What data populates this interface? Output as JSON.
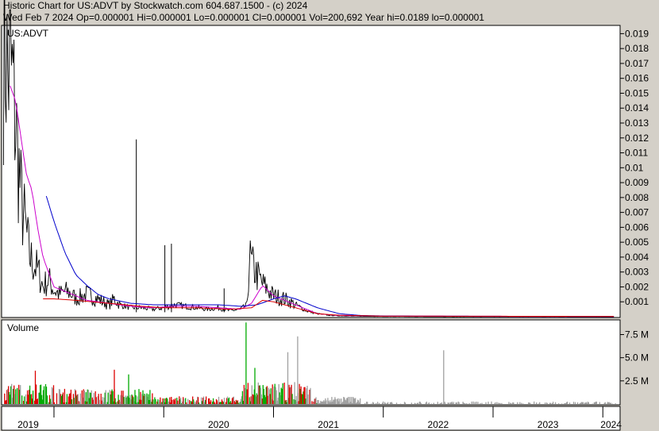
{
  "header": {
    "title": "Historic Chart for US:ADVT by Stockwatch.com 604.687.1500 - (c) 2024",
    "stats": "Wed Feb  7 2024   Op=0.000001   Hi=0.000001   Lo=0.000001   Cl=0.000001   Vol=200,692   Year hi=0.0189   lo=0.000001"
  },
  "chart_data": [
    {
      "type": "line",
      "title": "US:ADVT",
      "time_range": [
        "2018-07",
        "2024-02"
      ],
      "ylim": [
        0,
        0.0195
      ],
      "y_ticks": [
        0.001,
        0.002,
        0.003,
        0.004,
        0.005,
        0.006,
        0.007,
        0.008,
        0.009,
        0.01,
        0.011,
        0.012,
        0.013,
        0.014,
        0.015,
        0.016,
        0.017,
        0.018,
        0.019
      ],
      "y_tick_labels": [
        "0.001",
        "0.002",
        "0.003",
        "0.004",
        "0.005",
        "0.006",
        "0.007",
        "0.008",
        "0.009",
        "0.01",
        "0.011",
        "0.012",
        "0.013",
        "0.014",
        "0.015",
        "0.016",
        "0.017",
        "0.018",
        "0.019"
      ],
      "x_tick_labels": [
        "2019",
        "2020",
        "2021",
        "2022",
        "2023",
        "2024"
      ],
      "series": [
        {
          "kind": "price",
          "color": "#000000",
          "x": [
            2018.54,
            2018.56,
            2018.58,
            2018.6,
            2018.63,
            2018.66,
            2018.7,
            2018.74,
            2018.78,
            2018.82,
            2018.86,
            2018.9,
            2018.95,
            2019.0,
            2019.05,
            2019.1,
            2019.15,
            2019.2,
            2019.3,
            2019.4,
            2019.5,
            2019.55,
            2019.6,
            2019.7,
            2019.8,
            2019.9,
            2020.0,
            2020.05,
            2020.1,
            2020.2,
            2020.3,
            2020.4,
            2020.5,
            2020.6,
            2020.7,
            2020.76,
            2020.78,
            2020.8,
            2020.85,
            2020.9,
            2021.0,
            2021.1,
            2021.2,
            2021.3,
            2021.4,
            2021.5,
            2021.6,
            2021.7,
            2021.8,
            2022.0,
            2022.5,
            2023.0,
            2023.5,
            2024.1
          ],
          "y": [
            0.0185,
            0.018,
            0.016,
            0.017,
            0.015,
            0.012,
            0.008,
            0.006,
            0.004,
            0.0035,
            0.003,
            0.002,
            0.0025,
            0.0018,
            0.0015,
            0.0017,
            0.0016,
            0.0012,
            0.0015,
            0.0012,
            0.0008,
            0.0012,
            0.0008,
            0.0006,
            0.0006,
            0.0005,
            0.0006,
            0.0007,
            0.0008,
            0.0007,
            0.0006,
            0.0005,
            0.0006,
            0.0004,
            0.0005,
            0.0008,
            0.004,
            0.0035,
            0.0028,
            0.0022,
            0.0014,
            0.0012,
            0.0008,
            0.0004,
            0.0002,
            0.0001,
            6e-05,
            4e-05,
            3e-05,
            2e-05,
            1e-05,
            1e-05,
            1e-05,
            1e-06
          ]
        },
        {
          "kind": "spike",
          "color": "#000000",
          "x": [
            2019.75,
            2020.01,
            2020.07,
            2020.55
          ],
          "y": [
            0.0119,
            0.0048,
            0.0049,
            0.0019
          ]
        },
        {
          "kind": "ma-short",
          "color": "#cc00cc",
          "x": [
            2018.6,
            2018.65,
            2018.7,
            2018.75,
            2018.8,
            2018.85,
            2018.9,
            2019.0,
            2019.1,
            2019.2,
            2019.3,
            2019.5,
            2019.7,
            2019.9,
            2020.1,
            2020.3,
            2020.5,
            2020.7,
            2020.8,
            2020.9,
            2021.0,
            2021.2,
            2021.4,
            2021.6,
            2022.0,
            2023.0,
            2024.1
          ],
          "y": [
            0.0155,
            0.0145,
            0.012,
            0.0095,
            0.0085,
            0.006,
            0.004,
            0.002,
            0.0017,
            0.0014,
            0.0011,
            0.0009,
            0.0007,
            0.0006,
            0.0007,
            0.0007,
            0.0006,
            0.0005,
            0.0009,
            0.0021,
            0.0014,
            0.0008,
            0.0002,
            8e-05,
            4e-05,
            2e-05,
            1e-05
          ]
        },
        {
          "kind": "ma-long",
          "color": "#0000cc",
          "x": [
            2018.93,
            2019.0,
            2019.1,
            2019.2,
            2019.3,
            2019.4,
            2019.5,
            2019.7,
            2019.9,
            2020.1,
            2020.3,
            2020.5,
            2020.7,
            2020.85,
            2021.0,
            2021.1,
            2021.2,
            2021.4,
            2021.6,
            2021.8,
            2022.0,
            2023.0,
            2024.1
          ],
          "y": [
            0.0081,
            0.0064,
            0.0043,
            0.0028,
            0.0021,
            0.0015,
            0.0012,
            0.0009,
            0.0008,
            0.0008,
            0.0008,
            0.0008,
            0.0007,
            0.0008,
            0.0012,
            0.0014,
            0.0012,
            0.0006,
            0.0002,
            8e-05,
            5e-05,
            3e-05,
            2e-05
          ]
        },
        {
          "kind": "ma-red",
          "color": "#dd0000",
          "x": [
            2018.9,
            2019.0,
            2019.2,
            2019.5,
            2019.8,
            2020.0,
            2020.3,
            2020.6,
            2020.8,
            2020.9,
            2021.0,
            2021.2,
            2021.4,
            2021.6,
            2022.0,
            2024.1
          ],
          "y": [
            0.0012,
            0.0012,
            0.0011,
            0.0009,
            0.0007,
            0.0006,
            0.0006,
            0.0005,
            0.0006,
            0.0011,
            0.001,
            0.0006,
            0.0002,
            0.0001,
            4e-05,
            2e-05
          ]
        }
      ]
    },
    {
      "type": "bar",
      "title": "Volume",
      "ylim": [
        0,
        9000000
      ],
      "y_ticks": [
        2500000,
        5000000,
        7500000
      ],
      "y_tick_labels": [
        "2.5 M",
        "5.0 M",
        "7.5 M"
      ],
      "colors": {
        "up": "#00aa00",
        "down": "#dd0000",
        "flat": "#a0a0a0"
      },
      "highlights": [
        {
          "x": 2020.75,
          "value": 8800000,
          "dir": "up"
        },
        {
          "x": 2021.22,
          "value": 7300000,
          "dir": "flat"
        },
        {
          "x": 2021.13,
          "value": 5600000,
          "dir": "flat"
        },
        {
          "x": 2022.55,
          "value": 5800000,
          "dir": "flat"
        },
        {
          "x": 2018.83,
          "value": 3600000,
          "dir": "down"
        },
        {
          "x": 2019.55,
          "value": 3700000,
          "dir": "down"
        },
        {
          "x": 2019.68,
          "value": 3200000,
          "dir": "up"
        },
        {
          "x": 2020.83,
          "value": 3900000,
          "dir": "up"
        }
      ]
    }
  ]
}
